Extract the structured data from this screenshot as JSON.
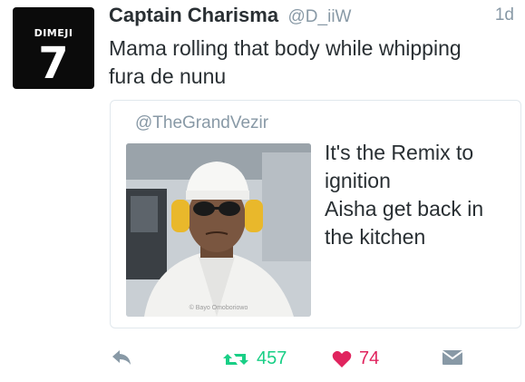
{
  "tweet": {
    "avatar_name": "DIMEJI",
    "avatar_number": "7",
    "display_name": "Captain Charisma",
    "handle": "@D_iiW",
    "timestamp": "1d",
    "text_line1": "Mama rolling that body while whipping",
    "text_line2": "fura de nunu"
  },
  "quote": {
    "handle": "@TheGrandVezir",
    "line1": "It's the Remix to",
    "line2": "ignition",
    "line3": "Aisha get back in",
    "line4": "the kitchen",
    "photo_watermark": "© Bayo Omoboriowo"
  },
  "actions": {
    "reply_icon": "reply-icon",
    "retweet_icon": "retweet-icon",
    "retweet_count": "457",
    "like_icon": "heart-icon",
    "like_count": "74",
    "dm_icon": "envelope-icon"
  },
  "colors": {
    "retweet": "#19cf86",
    "like": "#e0245e",
    "muted": "#8899a6",
    "text": "#292f33"
  }
}
